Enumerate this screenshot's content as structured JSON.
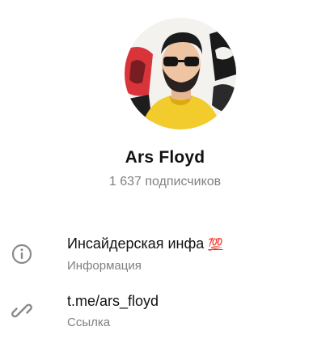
{
  "channel": {
    "name": "Ars Floyd",
    "subscribers": "1 637 подписчиков"
  },
  "info_row": {
    "icon": "info-icon",
    "value": "Инсайдерская инфа",
    "emoji": "💯",
    "label": "Информация"
  },
  "link_row": {
    "icon": "link-icon",
    "value": "t.me/ars_floyd",
    "label": "Ссылка"
  }
}
